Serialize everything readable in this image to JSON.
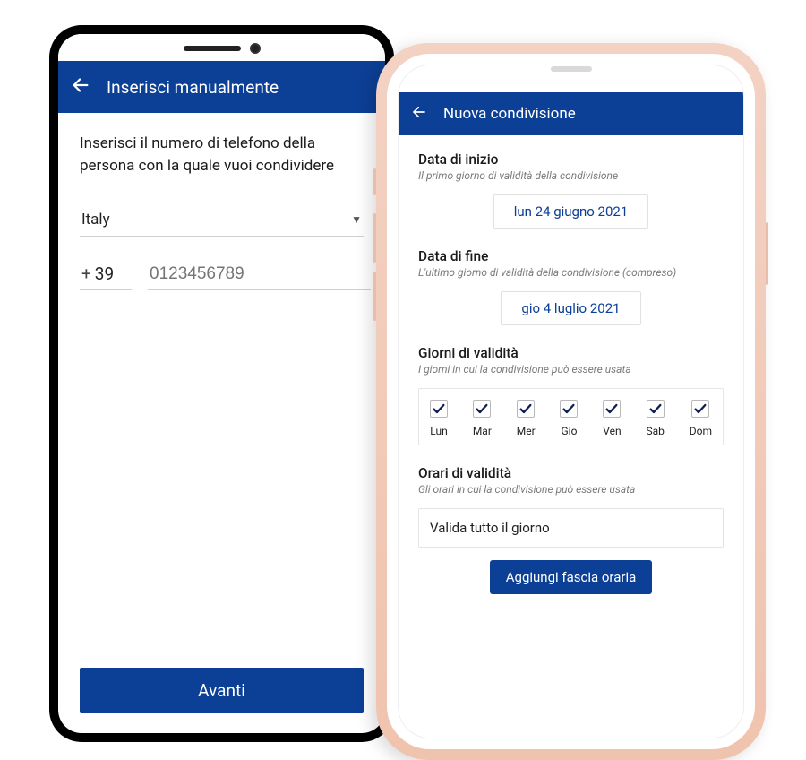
{
  "left": {
    "appbar_title": "Inserisci manualmente",
    "instruction": "Inserisci il numero di telefono della persona con la quale vuoi condividere",
    "country": "Italy",
    "prefix_plus": "+",
    "prefix_code": "39",
    "phone_placeholder": "0123456789",
    "next_button": "Avanti"
  },
  "right": {
    "appbar_title": "Nuova condivisione",
    "start": {
      "label": "Data di inizio",
      "hint": "Il primo giorno di validità della condivisione",
      "value": "lun 24 giugno 2021"
    },
    "end": {
      "label": "Data di fine",
      "hint": "L'ultimo giorno di validità della condivisione (compreso)",
      "value": "gio 4 luglio 2021"
    },
    "days": {
      "label": "Giorni di validità",
      "hint": "I giorni in cui la condivisione può essere usata",
      "items": [
        "Lun",
        "Mar",
        "Mer",
        "Gio",
        "Ven",
        "Sab",
        "Dom"
      ]
    },
    "hours": {
      "label": "Orari di validità",
      "hint": "Gli orari in cui la condivisione può essere usata",
      "all_day": "Valida tutto il giorno",
      "add_slot": "Aggiungi fascia oraria"
    }
  }
}
